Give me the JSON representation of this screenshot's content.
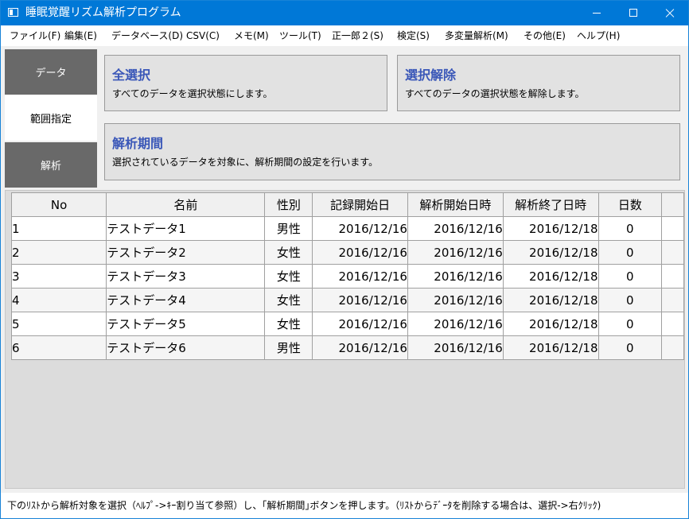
{
  "window": {
    "title": "睡眠覚醒リズム解析プログラム"
  },
  "menu": [
    "ファイル(F)",
    "編集(E)",
    "データベース(D)",
    "CSV(C)",
    "メモ(M)",
    "ツール(T)",
    "正一郎２(S)",
    "検定(S)",
    "多変量解析(M)",
    "その他(E)",
    "ヘルプ(H)"
  ],
  "nav": {
    "tabs": [
      "データ",
      "範囲指定",
      "解析"
    ],
    "active": "範囲指定"
  },
  "actions": {
    "select_all": {
      "title": "全選択",
      "desc": "すべてのデータを選択状態にします。"
    },
    "deselect_all": {
      "title": "選択解除",
      "desc": "すべてのデータの選択状態を解除します。"
    },
    "period": {
      "title": "解析期間",
      "desc": "選択されているデータを対象に、解析期間の設定を行います。"
    }
  },
  "table": {
    "columns": [
      "No",
      "名前",
      "性別",
      "記録開始日",
      "解析開始日時",
      "解析終了日時",
      "日数"
    ],
    "rows": [
      [
        "1",
        "テストデータ1",
        "男性",
        "2016/12/16",
        "2016/12/16",
        "2016/12/18",
        "0"
      ],
      [
        "2",
        "テストデータ2",
        "女性",
        "2016/12/16",
        "2016/12/16",
        "2016/12/18",
        "0"
      ],
      [
        "3",
        "テストデータ3",
        "女性",
        "2016/12/16",
        "2016/12/16",
        "2016/12/18",
        "0"
      ],
      [
        "4",
        "テストデータ4",
        "女性",
        "2016/12/16",
        "2016/12/16",
        "2016/12/18",
        "0"
      ],
      [
        "5",
        "テストデータ5",
        "女性",
        "2016/12/16",
        "2016/12/16",
        "2016/12/18",
        "0"
      ],
      [
        "6",
        "テストデータ6",
        "男性",
        "2016/12/16",
        "2016/12/16",
        "2016/12/18",
        "0"
      ]
    ]
  },
  "status": {
    "text": "下のﾘｽﾄから解析対象を選択（ﾍﾙﾌﾟ->ｷｰ割り当て参照）し、｢解析期間｣ボタンを押します。（ﾘｽﾄからﾃﾞｰﾀを削除する場合は、選択->右ｸﾘｯｸ)"
  },
  "colors": {
    "titlebar": "#0078d7",
    "nav_dark": "#696969",
    "card_bg": "#e2e2e2",
    "card_title": "#3a57b8"
  }
}
